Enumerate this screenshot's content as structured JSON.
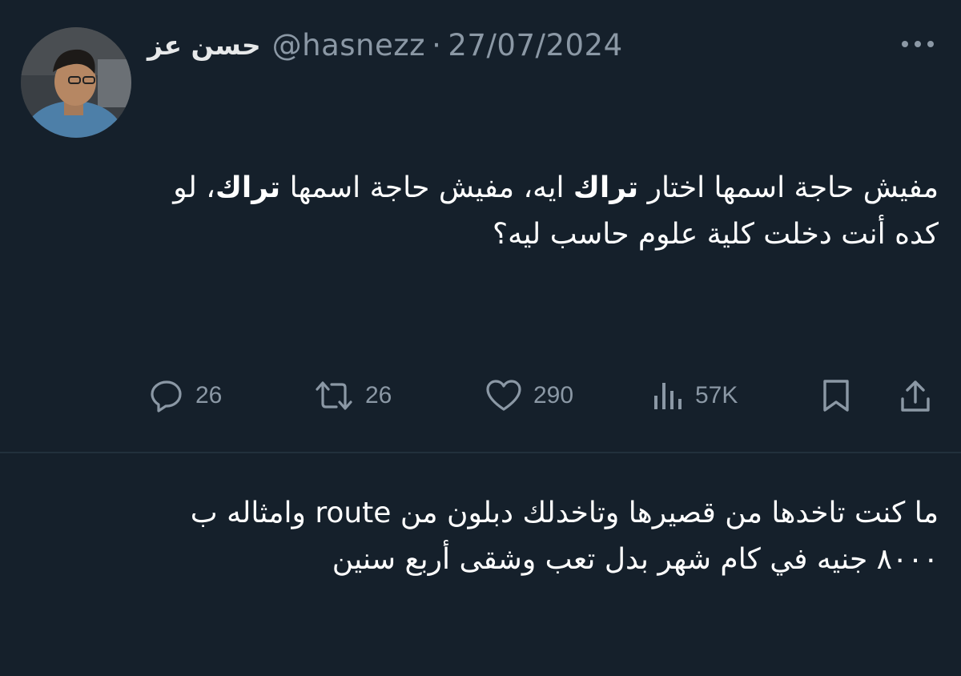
{
  "user": {
    "display_name": "حسن عز",
    "handle": "@hasnezz",
    "separator": "·",
    "date": "27/07/2024"
  },
  "tweet": {
    "para1": {
      "part1": "مفيش حاجة اسمها اختار ",
      "bold1": "تراك",
      "part2": " ايه، مفيش حاجة اسمها ",
      "bold2": "تراك",
      "part3": "، لو كده أنت دخلت كلية علوم حاسب ليه؟"
    },
    "para2": "ما كنت تاخدها من قصيرها وتاخدلك دبلون من route وامثاله ب ٨٠٠٠ جنيه في كام شهر بدل تعب وشقى أربع سنين"
  },
  "actions": {
    "replies": "26",
    "retweets": "26",
    "likes": "290",
    "views": "57K"
  },
  "icons": {
    "more": "more-horizontal-icon",
    "reply": "reply-icon",
    "retweet": "retweet-icon",
    "like": "heart-icon",
    "views": "views-icon",
    "bookmark": "bookmark-icon",
    "share": "share-icon"
  },
  "colors": {
    "background": "#15202b",
    "text": "#ffffff",
    "muted": "#8b98a5"
  }
}
